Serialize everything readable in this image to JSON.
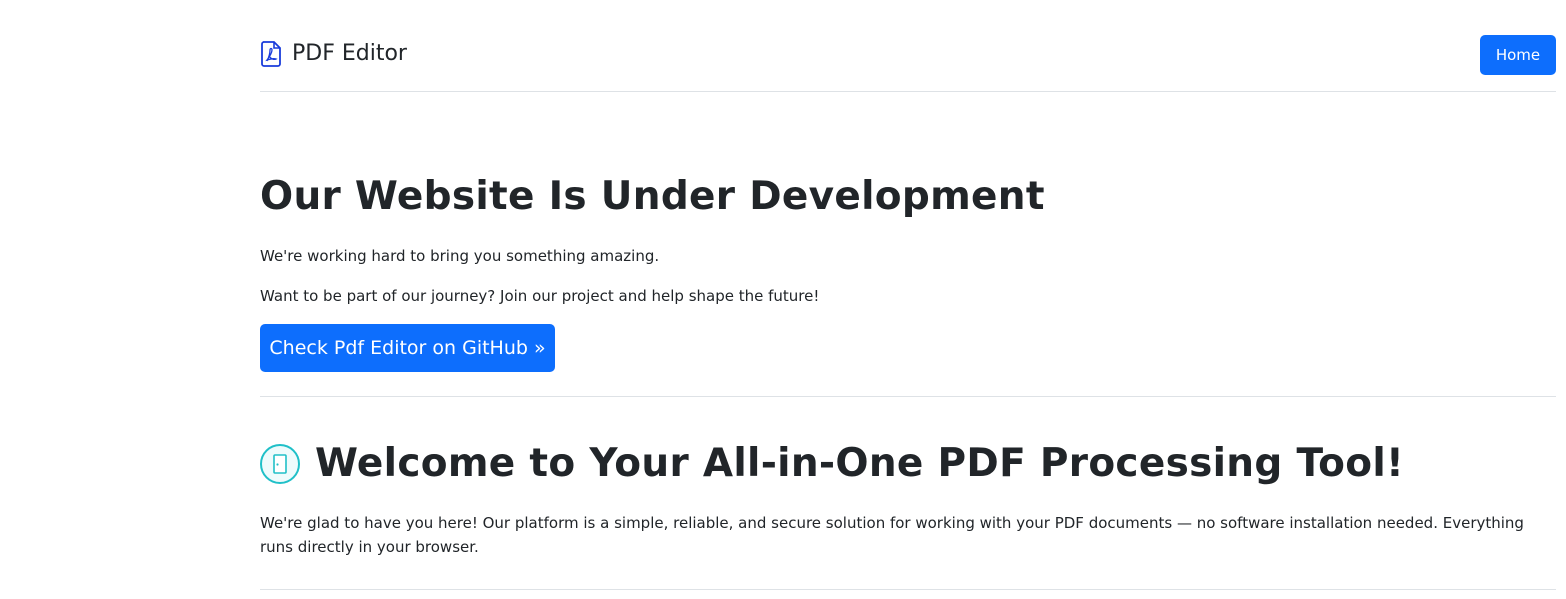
{
  "header": {
    "brand": "PDF Editor",
    "brand_icon": "pdf-file-icon",
    "home_label": "Home"
  },
  "hero": {
    "title": "Our Website Is Under Development",
    "line1": "We're working hard to bring you something amazing.",
    "line2": "Want to be part of our journey? Join our project and help shape the future!",
    "github_button": "Check Pdf Editor on GitHub »"
  },
  "welcome": {
    "icon": "door-icon",
    "title": "Welcome to Your All-in-One PDF Processing Tool!",
    "text": "We're glad to have you here! Our platform is a simple, reliable, and secure solution for working with your PDF documents — no software installation needed. Everything runs directly in your browser."
  },
  "colors": {
    "primary": "#0d6efd",
    "text": "#212529",
    "divider": "#dee2e6",
    "accent_teal": "#20c0c8",
    "brand_icon": "#1a3cdb"
  }
}
